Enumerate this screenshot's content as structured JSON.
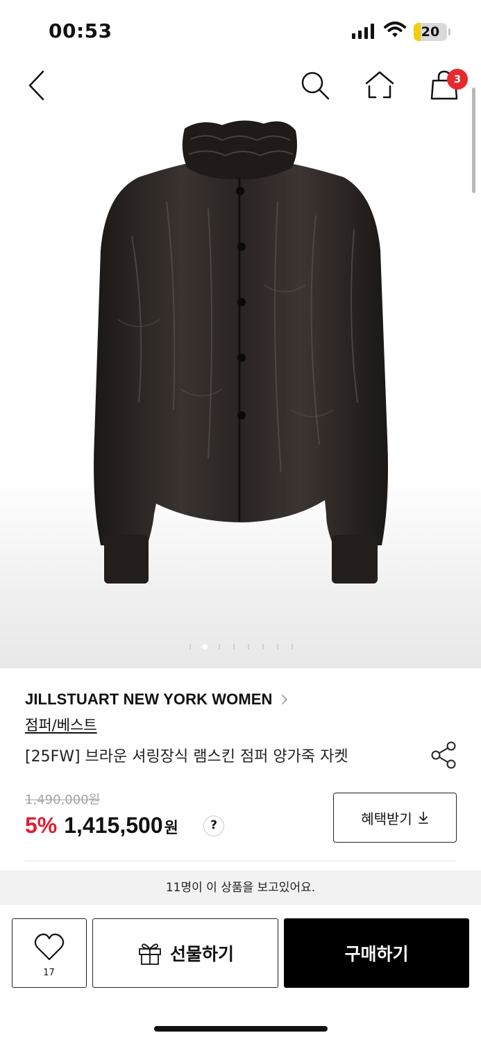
{
  "status_bar": {
    "time": "00:53",
    "battery_level": "20",
    "battery_fraction": 0.2,
    "icons": [
      "cellular-signal-icon",
      "wifi-icon",
      "battery-icon"
    ]
  },
  "nav": {
    "icons": [
      "back-chevron-icon",
      "search-icon",
      "home-icon",
      "shopping-bag-icon"
    ],
    "cart_count": "3"
  },
  "gallery": {
    "image_description_icon": "leather-jacket-photo",
    "page_count": 8,
    "active_index": 2
  },
  "product": {
    "brand": "JILLSTUART NEW YORK WOMEN",
    "category": "점퍼/베스트",
    "title": "[25FW] 브라운 셔링장식 램스킨 점퍼 양가죽 자켓",
    "original_price": "1,490,000원",
    "discount": "5%",
    "sale_price": "1,415,500",
    "currency": "원",
    "help_label": "?",
    "benefit_button": "혜택받기"
  },
  "viewers_text": "11명이 이 상품을 보고있어요.",
  "actions": {
    "like_count": "17",
    "gift_label": "선물하기",
    "buy_label": "구매하기"
  },
  "colors": {
    "accent_red": "#e01e34",
    "badge_red": "#e8282b",
    "buy_button": "#000000",
    "battery_yellow": "#f4cc0b"
  }
}
